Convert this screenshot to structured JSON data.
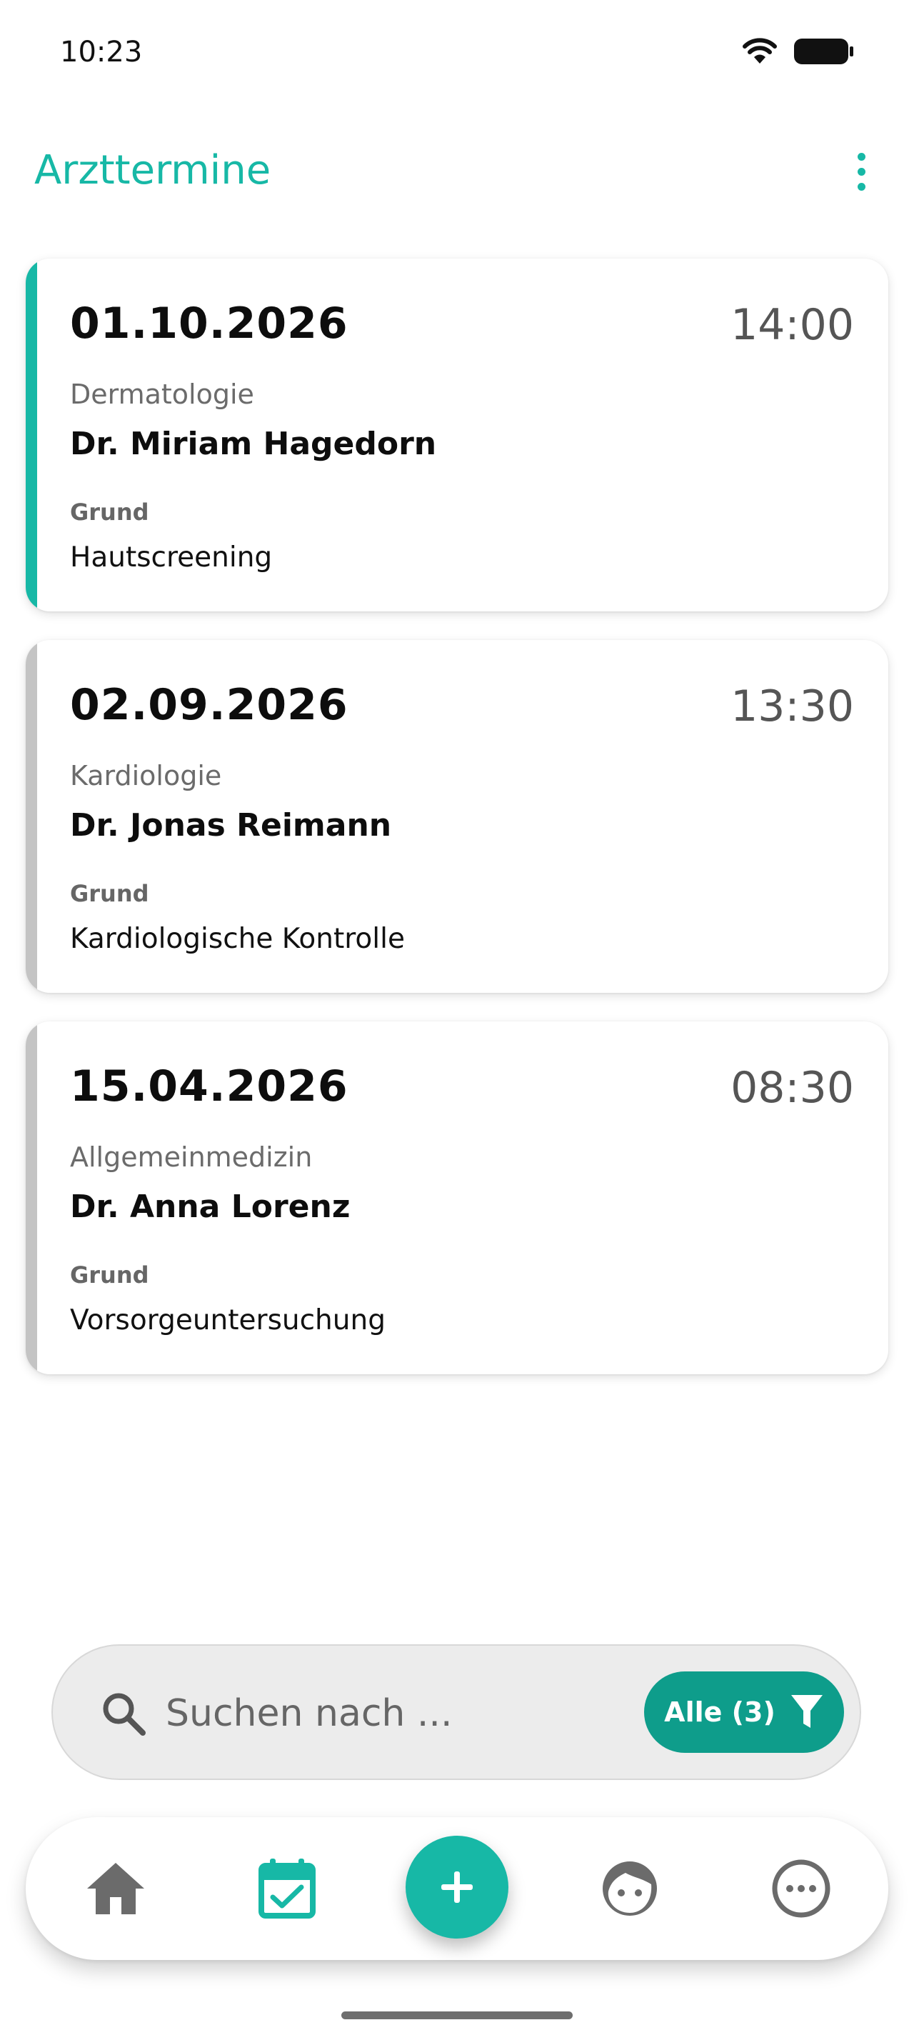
{
  "status_bar": {
    "time": "10:23"
  },
  "header": {
    "title": "Arzttermine"
  },
  "appointments": [
    {
      "date": "01.10.2026",
      "time": "14:00",
      "department": "Dermatologie",
      "doctor": "Dr. Miriam Hagedorn",
      "reason_label": "Grund",
      "reason": "Hautscreening",
      "active": true
    },
    {
      "date": "02.09.2026",
      "time": "13:30",
      "department": "Kardiologie",
      "doctor": "Dr. Jonas Reimann",
      "reason_label": "Grund",
      "reason": "Kardiologische Kontrolle",
      "active": false
    },
    {
      "date": "15.04.2026",
      "time": "08:30",
      "department": "Allgemeinmedizin",
      "doctor": "Dr. Anna Lorenz",
      "reason_label": "Grund",
      "reason": "Vorsorgeuntersuchung",
      "active": false
    }
  ],
  "search": {
    "placeholder": "Suchen nach ...",
    "value": ""
  },
  "filter": {
    "label": "Alle (3)"
  },
  "nav": {
    "items": [
      {
        "icon": "home-icon",
        "active": false
      },
      {
        "icon": "calendar-check-icon",
        "active": true
      },
      {
        "icon": "plus-icon",
        "active": false
      },
      {
        "icon": "face-icon",
        "active": false
      },
      {
        "icon": "more-icon",
        "active": false
      }
    ]
  },
  "colors": {
    "accent": "#17b8a6",
    "filter_button": "#0e9d8b",
    "inactive_bar": "#c4c4c4",
    "icon_gray": "#6b6b6b"
  }
}
